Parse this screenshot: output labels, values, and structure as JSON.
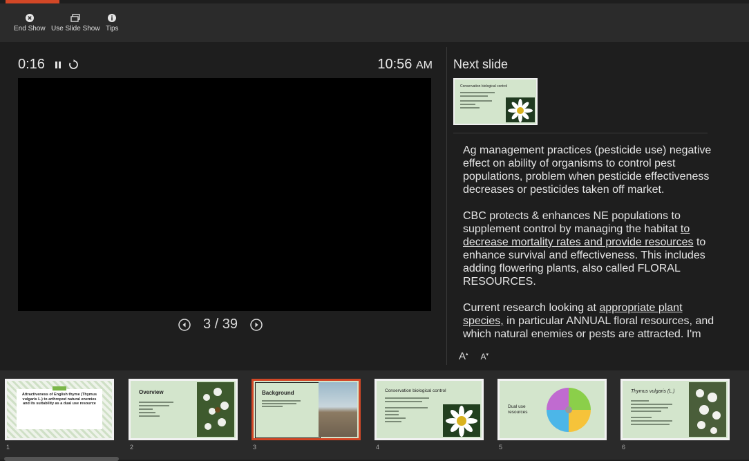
{
  "toolbar": {
    "end_show": "End Show",
    "use_slide_show": "Use Slide Show",
    "tips": "Tips"
  },
  "timer": {
    "elapsed": "0:16"
  },
  "clock": {
    "time": "10:56",
    "ampm": "AM"
  },
  "navigation": {
    "page": "3 / 39"
  },
  "next_slide": {
    "label": "Next slide",
    "thumb_title": "Conservation biological control"
  },
  "notes": {
    "p1": "Ag management practices (pesticide use) negative effect on ability of organisms to control pest populations, problem when pesticide effectiveness decreases or pesticides taken off market.",
    "p2_a": "CBC protects & enhances NE populations to supplement control by managing the habitat",
    "p2_u": "to decrease mortality rates and provide resources",
    "p2_b": "to enhance survival and effectiveness. This includes adding flowering plants, also called FLORAL RESOURCES.",
    "p3_a": "Current research looking at",
    "p3_u": "appropriate plant species,",
    "p3_b": "in particular ANNUAL floral resources, and which natural enemies or pests are attracted. I'm"
  },
  "font_controls": {
    "increase": "A",
    "decrease": "A"
  },
  "slides": [
    {
      "number": "1",
      "title": "Attractiveness of English thyme (Thymus vulgaris L.) to arthropod natural enemies and its suitability as a dual use resource"
    },
    {
      "number": "2",
      "title": "Overview"
    },
    {
      "number": "3",
      "title": "Background"
    },
    {
      "number": "4",
      "title": "Conservation biological control"
    },
    {
      "number": "5",
      "title": "Dual use resources"
    },
    {
      "number": "6",
      "title": "Thymus vulgaris (L.)"
    }
  ],
  "colors": {
    "accent": "#d24726",
    "slide_bg": "#d3e5cc",
    "panel": "#1e1e1e"
  }
}
